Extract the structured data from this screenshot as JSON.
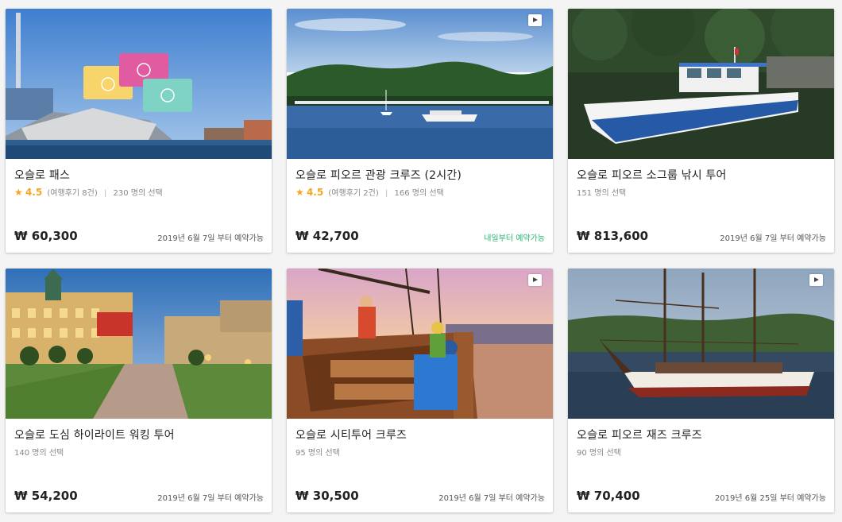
{
  "colors": {
    "accent_green": "#2bb573",
    "star": "#f5a623",
    "text": "#222222",
    "muted": "#888888"
  },
  "products": [
    {
      "title": "오슬로 패스",
      "rating": "4.5",
      "reviews": "(여행후기 8건)",
      "selected": "230 명의 선택",
      "price": "₩ 60,300",
      "availability": "2019년 6월 7일 부터 예약가능",
      "has_video": false,
      "image": "oslo-pass-cards-harbor"
    },
    {
      "title": "오슬로 피오르 관광 크루즈 (2시간)",
      "rating": "4.5",
      "reviews": "(여행후기 2건)",
      "selected": "166 명의 선택",
      "price": "₩ 42,700",
      "availability": "내일부터 예약가능",
      "has_video": true,
      "image": "fjord-marina"
    },
    {
      "title": "오슬로 피오르 소그룹 낚시 투어",
      "selected": "151 명의 선택",
      "price": "₩ 813,600",
      "availability": "2019년 6월 7일 부터 예약가능",
      "has_video": false,
      "image": "fishing-boat"
    },
    {
      "title": "오슬로 도심 하이라이트 워킹 투어",
      "selected": "140 명의 선택",
      "price": "₩ 54,200",
      "availability": "2019년 6월 7일 부터 예약가능",
      "has_video": false,
      "image": "city-square-dusk"
    },
    {
      "title": "오슬로 시티투어 크루즈",
      "selected": "95 명의 선택",
      "price": "₩ 30,500",
      "availability": "2019년 6월 7일 부터 예약가능",
      "has_video": true,
      "image": "sailboat-deck-sunset"
    },
    {
      "title": "오슬로 피오르 재즈 크루즈",
      "selected": "90 명의 선택",
      "price": "₩ 70,400",
      "availability": "2019년 6월 25일 부터 예약가능",
      "has_video": true,
      "image": "tall-ship"
    }
  ]
}
